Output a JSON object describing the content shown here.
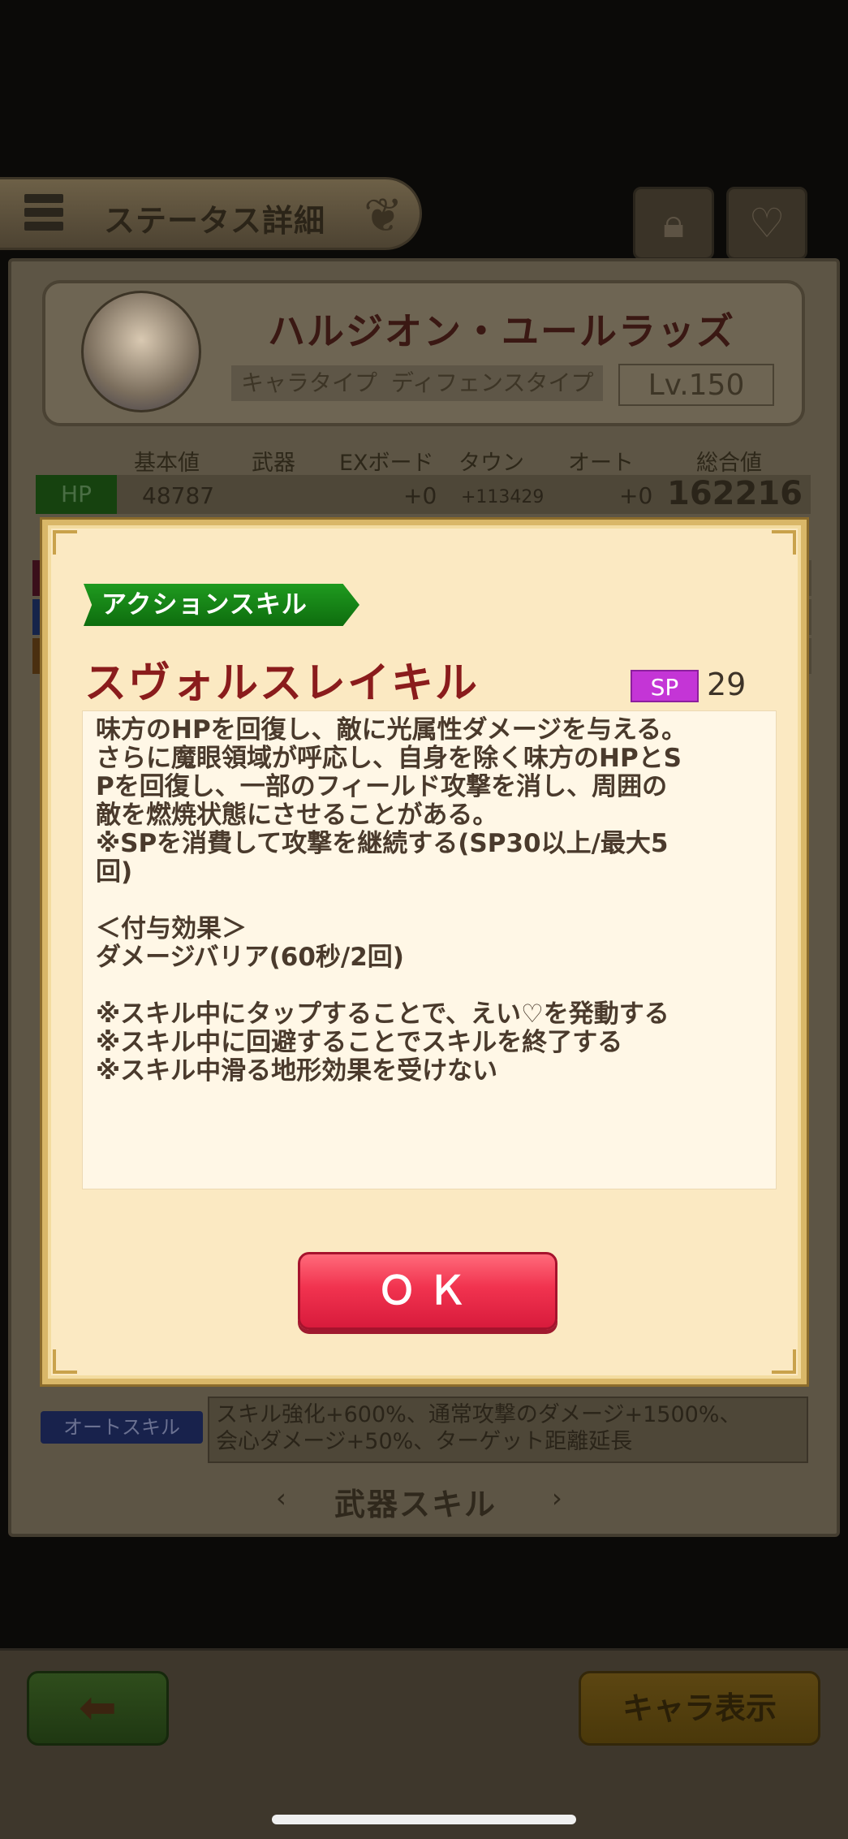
{
  "header": {
    "title": "ステータス詳細"
  },
  "character": {
    "name": "ハルジオン・ユールラッズ",
    "chara_type": "キャラタイプ",
    "defense_type": "ディフェンスタイプ",
    "level": "Lv.150"
  },
  "stats": {
    "columns": [
      "基本値",
      "武器",
      "EXボード",
      "タウン",
      "オート",
      "総合値"
    ],
    "hp": {
      "label": "HP",
      "base": "48787",
      "exboard": "+0",
      "town": "+113429",
      "auto": "+0",
      "total": "162216"
    }
  },
  "dialog": {
    "skill_category": "アクションスキル",
    "skill_name": "スヴォルスレイキル",
    "sp_label": "SP",
    "sp_value": "29",
    "description_lines": [
      "味方のHPを回復し、敵に光属性ダメージを与える。",
      "さらに魔眼領域が呼応し、自身を除く味方のHPとS",
      "Pを回復し、一部のフィールド攻撃を消し、周囲の",
      "敵を燃焼状態にさせることがある。",
      "※SPを消費して攻撃を継続する(SP30以上/最大5",
      "回)",
      "",
      "＜付与効果＞",
      "ダメージバリア(60秒/2回)",
      "",
      "※スキル中にタップすることで、えい♡を発動する",
      "※スキル中に回避することでスキルを終了する",
      "※スキル中滑る地形効果を受けない"
    ],
    "ok_label": "ＯＫ"
  },
  "auto_skill": {
    "tag": "オートスキル",
    "line1": "スキル強化+600%、通常攻撃のダメージ+1500%、",
    "line2": "会心ダメージ+50%、ターゲット距離延長"
  },
  "weapon_skill": {
    "label": "武器スキル"
  },
  "footer": {
    "chara_button": "キャラ表示"
  },
  "icons": [
    "menu-icon",
    "lock-icon",
    "heart-icon",
    "back-arrow-icon",
    "chevron-left-icon",
    "chevron-right-icon"
  ],
  "colors": {
    "skill_name": "#8a1c1c",
    "ok_button": "#f1334f",
    "sp_badge": "#c435d6",
    "category_badge": "#1f9a1f"
  }
}
